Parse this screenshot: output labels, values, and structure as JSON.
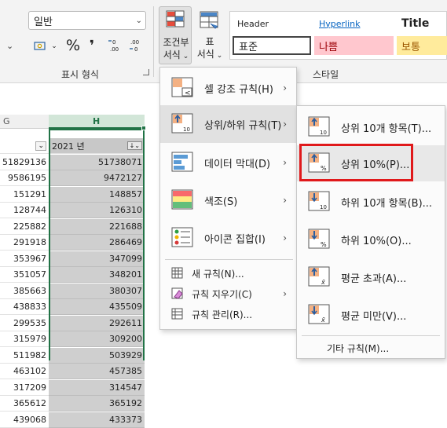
{
  "ribbon": {
    "number_format_value": "일반",
    "number_group_label": "표시 형식",
    "conditional_format_label_1": "조건부",
    "conditional_format_label_2": "서식",
    "format_table_label_1": "표",
    "format_table_label_2": "서식",
    "styles_group_label": "스타일",
    "styles": {
      "header": "Header",
      "hyperlink": "Hyperlink",
      "title": "Title",
      "normal": "표준",
      "bad": "나쁨",
      "neutral": "보통"
    },
    "percent_symbol": "%",
    "comma_symbol": "❜"
  },
  "sheet": {
    "col_g": "G",
    "col_h": "H",
    "header_cell": "2021 년",
    "col_g_values": [
      "51829136",
      "9586195",
      "151291",
      "128744",
      "225882",
      "291918",
      "353967",
      "351057",
      "385663",
      "438833",
      "299535",
      "315979",
      "511982",
      "463102",
      "317209",
      "365612",
      "439068"
    ],
    "col_h_values": [
      "51738071",
      "9472127",
      "148857",
      "126310",
      "221688",
      "286469",
      "347099",
      "348201",
      "380307",
      "435509",
      "292611",
      "309200",
      "503929",
      "457385",
      "314547",
      "365192",
      "433373"
    ]
  },
  "menu_main": {
    "items": [
      {
        "label": "셀 강조 규칙(H)",
        "name": "highlight-cells-rules"
      },
      {
        "label": "상위/하위 규칙(T)",
        "name": "top-bottom-rules"
      },
      {
        "label": "데이터 막대(D)",
        "name": "data-bars"
      },
      {
        "label": "색조(S)",
        "name": "color-scales"
      },
      {
        "label": "아이콘 집합(I)",
        "name": "icon-sets"
      }
    ],
    "small_items": [
      {
        "label": "새 규칙(N)..."
      },
      {
        "label": "규칙 지우기(C)"
      },
      {
        "label": "규칙 관리(R)..."
      }
    ]
  },
  "menu_sub": {
    "items": [
      {
        "label": "상위 10개 항목(T)...",
        "icon_text": "10"
      },
      {
        "label": "상위 10%(P)...",
        "icon_text": "%"
      },
      {
        "label": "하위 10개 항목(B)...",
        "icon_text": "10"
      },
      {
        "label": "하위 10%(O)...",
        "icon_text": "%"
      },
      {
        "label": "평균 초과(A)...",
        "icon_text": "x̄"
      },
      {
        "label": "평균 미만(V)...",
        "icon_text": "x̄"
      }
    ],
    "more_rules": "기타 규칙(M)..."
  },
  "colors": {
    "accent_green": "#217346",
    "highlight_red": "#e0191b",
    "bad_bg": "#ffc7ce",
    "bad_fg": "#9c0006",
    "neutral_bg": "#ffeb9c",
    "neutral_fg": "#9c5700"
  }
}
